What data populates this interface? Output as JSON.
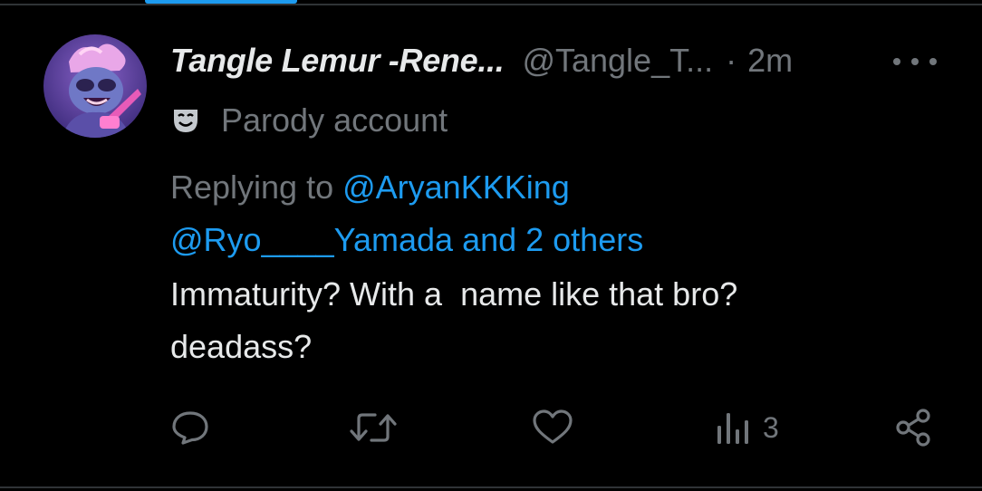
{
  "tweet": {
    "display_name": "Tangle Lemur -Rene...",
    "handle": "@Tangle_T...",
    "separator": "·",
    "time": "2m",
    "badge_label": "Parody account",
    "replying_prefix": "Replying to ",
    "reply_mention_1": "@AryanKKKing",
    "reply_mention_2": "@Ryo____Yamada and 2 others",
    "text_line_1": "Immaturity? With a  name like that bro?",
    "text_line_2": "deadass?",
    "views_count": "3"
  },
  "icons": {
    "avatar": "lemur-avatar",
    "badge": "theater-mask-icon",
    "more": "more-icon",
    "reply": "reply-icon",
    "retweet": "retweet-icon",
    "like": "like-icon",
    "views": "views-icon",
    "share": "share-icon"
  },
  "colors": {
    "background": "#000000",
    "text_primary": "#e7e9ea",
    "text_secondary": "#71767b",
    "accent": "#1d9bf0"
  }
}
